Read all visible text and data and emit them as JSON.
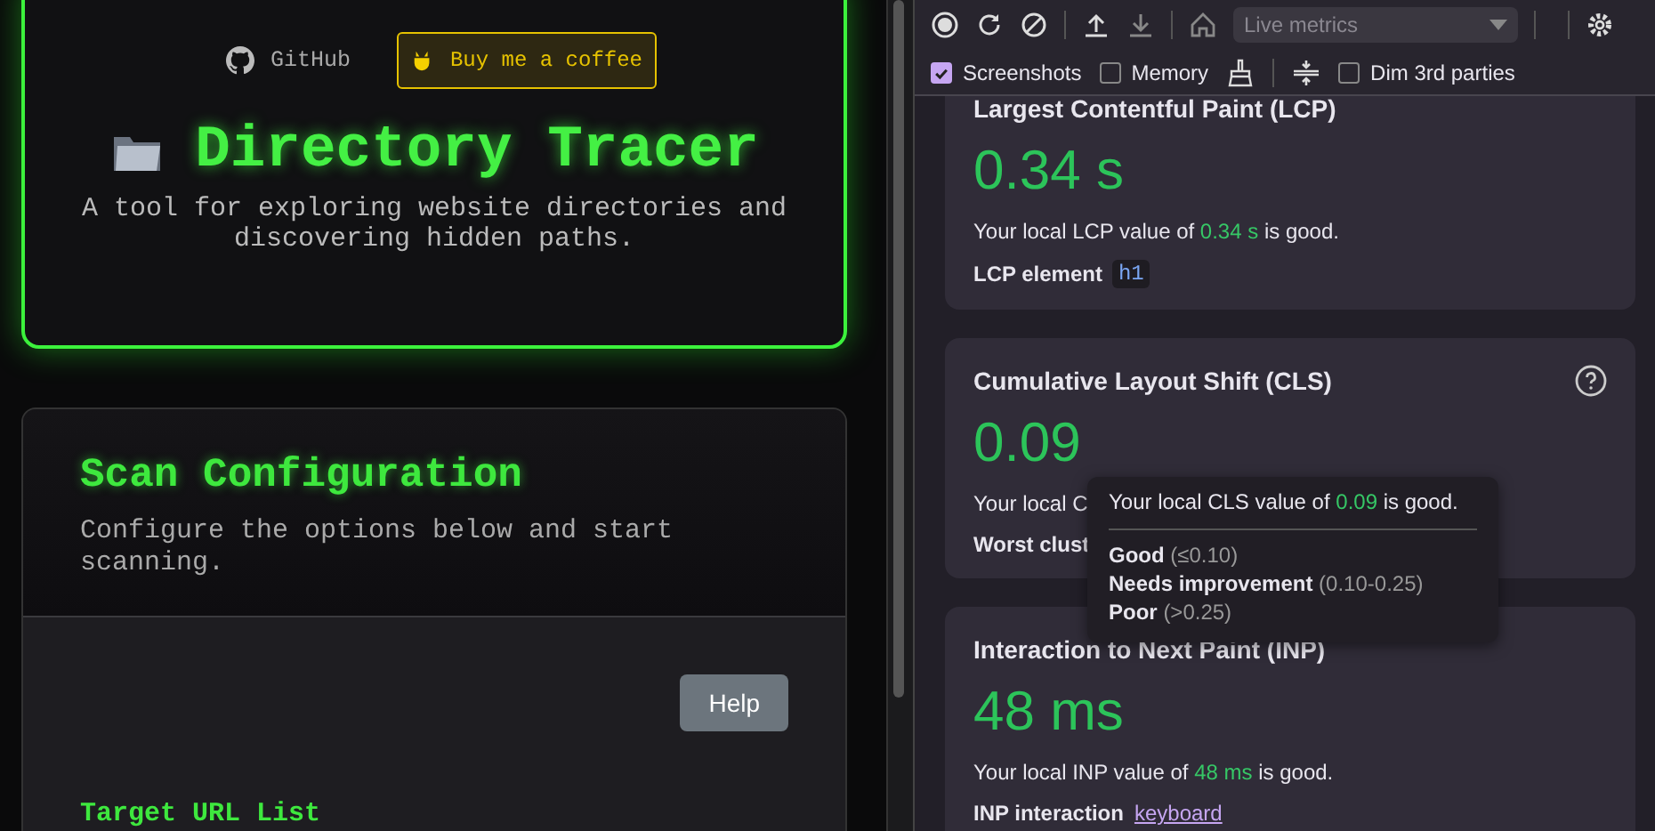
{
  "page": {
    "links": [
      {
        "kind": "github",
        "label": "GitHub"
      },
      {
        "kind": "coffee",
        "label": "Buy me a coffee"
      }
    ],
    "title": "Directory Tracer",
    "subtitle": "A tool for exploring website directories and discovering hidden paths.",
    "config": {
      "title": "Scan Configuration",
      "description": "Configure the options below and start scanning.",
      "help_button": "Help",
      "field_label": "Target URL List"
    }
  },
  "devtools": {
    "toolbar": {
      "dropdown": "Live metrics",
      "options": [
        {
          "label": "Screenshots",
          "checked": true
        },
        {
          "label": "Memory",
          "checked": false
        },
        {
          "label": "Dim 3rd parties",
          "checked": false
        }
      ]
    },
    "metrics": [
      {
        "title": "Largest Contentful Paint (LCP)",
        "value": "0.34 s",
        "help": false,
        "summary_before": "Your local LCP value of ",
        "summary_value": "0.34 s",
        "summary_after": " is good.",
        "detail": {
          "kind": "code",
          "label": "LCP element",
          "value": "h1"
        }
      },
      {
        "title": "Cumulative Layout Shift (CLS)",
        "value": "0.09",
        "help": true,
        "summary_before": "Your local C",
        "detail": {
          "kind": "plain",
          "label": "Worst clust"
        }
      },
      {
        "title": "Interaction to Next Paint (INP)",
        "value": "48 ms",
        "help": false,
        "summary_before": "Your local INP value of ",
        "summary_value": "48 ms",
        "summary_after": " is good.",
        "detail": {
          "kind": "link",
          "label": "INP interaction",
          "value": "keyboard"
        }
      }
    ],
    "tooltip": {
      "summary_before": "Your local CLS value of ",
      "summary_value": "0.09",
      "summary_after": " is good.",
      "thresholds": [
        {
          "label": "Good",
          "range": "(≤0.10)"
        },
        {
          "label": "Needs improvement",
          "range": "(0.10-0.25)"
        },
        {
          "label": "Poor",
          "range": "(>0.25)"
        }
      ]
    }
  }
}
